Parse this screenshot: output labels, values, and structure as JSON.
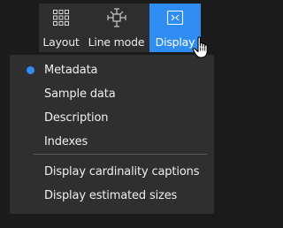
{
  "toolbar": {
    "buttons": [
      {
        "label": "Layout",
        "icon": "grid-icon"
      },
      {
        "label": "Line mode",
        "icon": "line-mode-icon"
      },
      {
        "label": "Display",
        "icon": "display-icon",
        "active": true
      }
    ]
  },
  "menu": {
    "items": [
      {
        "label": "Metadata",
        "selected": true
      },
      {
        "label": "Sample data",
        "selected": false
      },
      {
        "label": "Description",
        "selected": false
      },
      {
        "label": "Indexes",
        "selected": false
      }
    ],
    "options": [
      {
        "label": "Display cardinality captions"
      },
      {
        "label": "Display estimated sizes"
      }
    ]
  },
  "colors": {
    "accent": "#2f8cf0",
    "background": "#1b1b1b",
    "toolbar": "#2e2e2e",
    "menu": "#2f2f2f",
    "text": "#efefef"
  }
}
